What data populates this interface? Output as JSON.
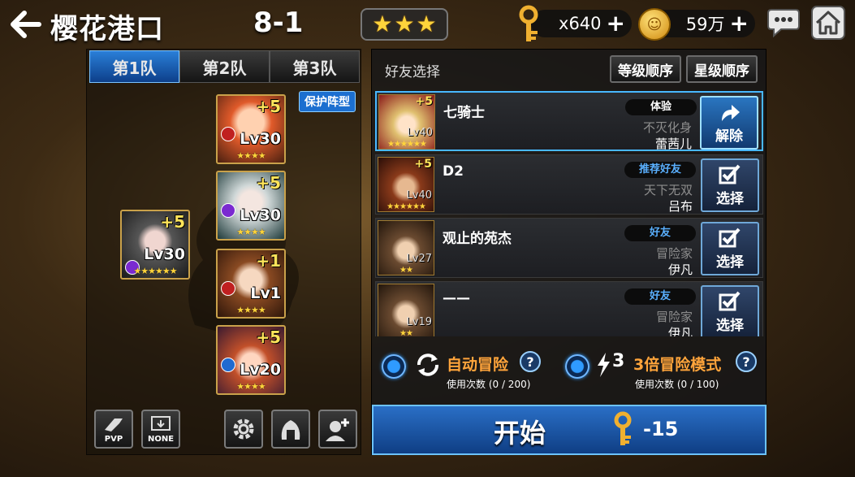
{
  "header": {
    "back_icon": "back-arrow-icon",
    "title": "樱花港口",
    "stage": "8-1",
    "stars": 3
  },
  "resources": {
    "keys": "x640",
    "gold": "59万",
    "plus": "+"
  },
  "teams": {
    "tabs": [
      "第1队",
      "第2队",
      "第3队"
    ],
    "active_tab": 0,
    "formation_label": "保护阵型"
  },
  "party": [
    {
      "bonus": "+5",
      "level": "Lv30",
      "stars": 4,
      "class": "warrior"
    },
    {
      "bonus": "+5",
      "level": "Lv30",
      "stars": 4,
      "class": "mage"
    },
    {
      "bonus": "+5",
      "level": "Lv30",
      "stars": 6,
      "class": "mage"
    },
    {
      "bonus": "+1",
      "level": "Lv1",
      "stars": 4,
      "class": "warrior"
    },
    {
      "bonus": "+5",
      "level": "Lv20",
      "stars": 4,
      "class": "support"
    }
  ],
  "bottom_buttons": {
    "pvp": "PVP",
    "none": "NONE"
  },
  "friends": {
    "header": "好友选择",
    "sort_level": "等级顺序",
    "sort_star": "星级顺序",
    "rows": [
      {
        "name": "七骑士",
        "tag": "体验",
        "title": "不灭化身",
        "hero": "蕾茜儿",
        "portrait_bonus": "+5",
        "portrait_level": "Lv40",
        "portrait_stars": 6,
        "button": "解除",
        "selected": true
      },
      {
        "name": "D2",
        "tag": "推荐好友",
        "title": "天下无双",
        "hero": "吕布",
        "portrait_bonus": "+5",
        "portrait_level": "Lv40",
        "portrait_stars": 6,
        "button": "选择",
        "selected": false
      },
      {
        "name": "观止的苑杰",
        "tag": "好友",
        "title": "冒险家",
        "hero": "伊凡",
        "portrait_bonus": "",
        "portrait_level": "Lv27",
        "portrait_stars": 2,
        "button": "选择",
        "selected": false
      },
      {
        "name": "——",
        "tag": "好友",
        "title": "冒险家",
        "hero": "伊凡",
        "portrait_bonus": "",
        "portrait_level": "Lv19",
        "portrait_stars": 2,
        "button": "选择",
        "selected": false
      }
    ]
  },
  "modes": {
    "auto": {
      "label": "自动冒险",
      "usage": "使用次数 (0 / 200)"
    },
    "triple": {
      "multiplier": "3",
      "label": "3倍冒险模式",
      "usage": "使用次数 (0 / 100)"
    },
    "help": "?"
  },
  "start": {
    "label": "开始",
    "cost": "-15"
  },
  "colors": {
    "accent_blue": "#2a6fc6",
    "gold_star": "#ffd43b",
    "mode_orange": "#ffa43b"
  }
}
